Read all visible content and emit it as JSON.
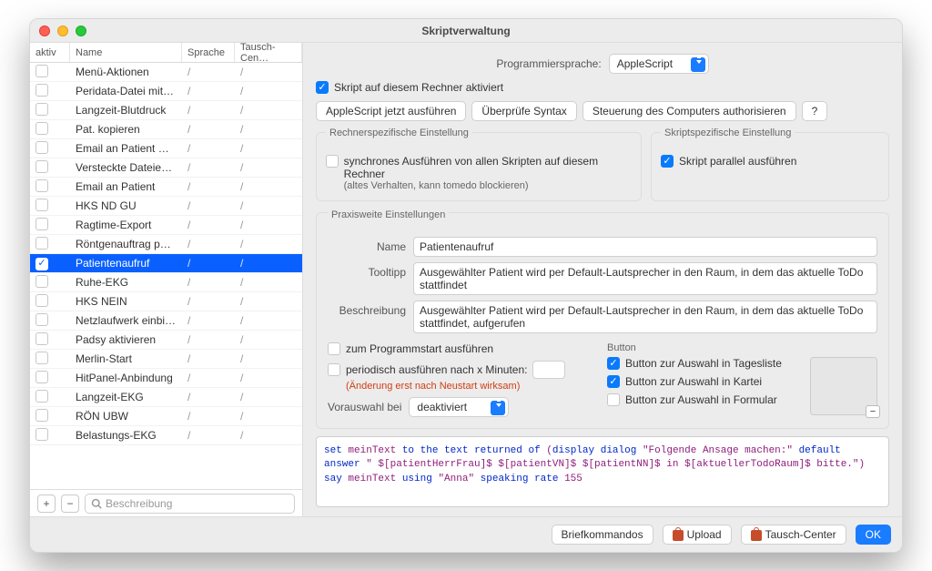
{
  "window_title": "Skriptverwaltung",
  "table": {
    "headers": {
      "aktiv": "aktiv",
      "name": "Name",
      "sprache": "Sprache",
      "tc": "Tausch-Cen…"
    },
    "search_placeholder": "Beschreibung",
    "rows": [
      {
        "aktiv": false,
        "name": "Menü-Aktionen"
      },
      {
        "aktiv": false,
        "name": "Peridata-Datei mit PatientID"
      },
      {
        "aktiv": false,
        "name": "Langzeit-Blutdruck"
      },
      {
        "aktiv": false,
        "name": "Pat. kopieren"
      },
      {
        "aktiv": false,
        "name": "Email an Patient mit iCal-Anha…"
      },
      {
        "aktiv": false,
        "name": "Versteckte Dateien anzeigen"
      },
      {
        "aktiv": false,
        "name": "Email an Patient"
      },
      {
        "aktiv": false,
        "name": "HKS ND GU"
      },
      {
        "aktiv": false,
        "name": "Ragtime-Export"
      },
      {
        "aktiv": false,
        "name": "Röntgenauftrag per GDT"
      },
      {
        "aktiv": true,
        "name": "Patientenaufruf",
        "selected": true
      },
      {
        "aktiv": false,
        "name": "Ruhe-EKG"
      },
      {
        "aktiv": false,
        "name": "HKS NEIN"
      },
      {
        "aktiv": false,
        "name": "Netzlaufwerk einbinden neu"
      },
      {
        "aktiv": false,
        "name": "Padsy aktivieren"
      },
      {
        "aktiv": false,
        "name": "Merlin-Start"
      },
      {
        "aktiv": false,
        "name": "HitPanel-Anbindung"
      },
      {
        "aktiv": false,
        "name": "Langzeit-EKG"
      },
      {
        "aktiv": false,
        "name": "RÖN UBW"
      },
      {
        "aktiv": false,
        "name": "Belastungs-EKG"
      }
    ]
  },
  "right": {
    "lang_label": "Programmiersprache:",
    "lang_value": "AppleScript",
    "active_label": "Skript auf diesem Rechner aktiviert",
    "btn_run": "AppleScript jetzt ausführen",
    "btn_syntax": "Überprüfe Syntax",
    "btn_auth": "Steuerung des Computers authorisieren",
    "btn_help": "?",
    "box_computer": {
      "title": "Rechnerspezifische Einstellung",
      "sync": "synchrones Ausführen von allen Skripten auf diesem Rechner",
      "sync2": "(altes Verhalten, kann tomedo blockieren)"
    },
    "box_script": {
      "title": "Skriptspezifische Einstellung",
      "parallel": "Skript parallel ausführen"
    },
    "box_praxis": {
      "title": "Praxisweite Einstellungen",
      "name_k": "Name",
      "name_v": "Patientenaufruf",
      "tip_k": "Tooltipp",
      "tip_v": "Ausgewählter Patient wird per Default-Lautsprecher in den Raum, in dem das aktuelle ToDo stattfindet",
      "desc_k": "Beschreibung",
      "desc_v": "Ausgewählter Patient wird per Default-Lautsprecher in den Raum, in dem das aktuelle ToDo stattfindet, aufgerufen",
      "startup": "zum Programmstart ausführen",
      "periodic": "periodisch ausführen nach x Minuten:",
      "periodic_note": "(Änderung erst nach Neustart wirksam)",
      "presel_k": "Vorauswahl bei",
      "presel_v": "deaktiviert",
      "button_hdr": "Button",
      "btn_day": "Button zur Auswahl in Tagesliste",
      "btn_kartei": "Button zur Auswahl in Kartei",
      "btn_form": "Button zur Auswahl in Formular"
    },
    "code": "set meinText to the text returned of (display dialog \"Folgende Ansage machen:\" default answer \" $[patientHerrFrau]$ $[patientVN]$ $[patientNN]$ in $[aktuellerTodoRaum]$ bitte.\")\nsay meinText using \"Anna\" speaking rate 155"
  },
  "footer": {
    "brief": "Briefkommandos",
    "upload": "Upload",
    "tc": "Tausch-Center",
    "ok": "OK"
  }
}
